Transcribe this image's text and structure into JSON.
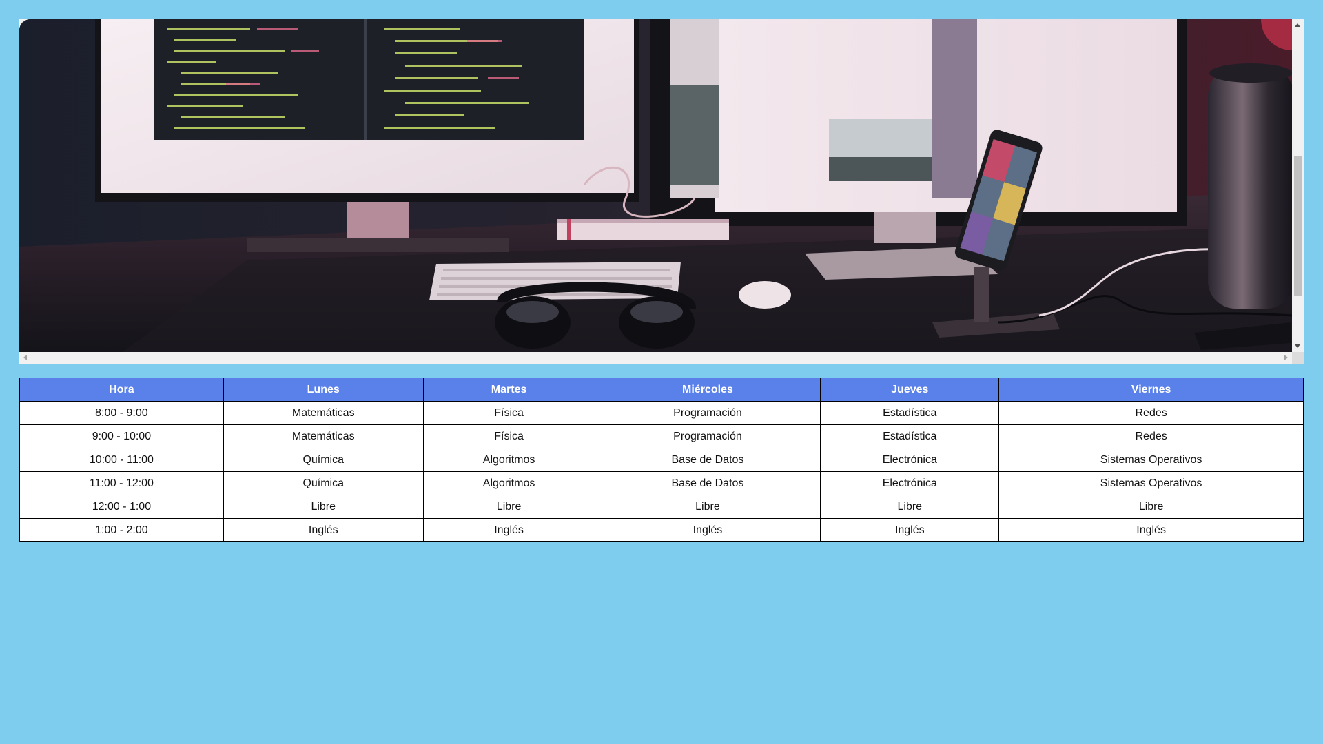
{
  "colors": {
    "page_background": "#7ecdef",
    "table_header": "#5a80ea",
    "table_header_text": "#ffffff",
    "table_cell_background": "#ffffff",
    "table_border": "#000000"
  },
  "banner": {
    "image_description_icon": "photo-icon"
  },
  "schedule": {
    "headers": [
      "Hora",
      "Lunes",
      "Martes",
      "Miércoles",
      "Jueves",
      "Viernes"
    ],
    "rows": [
      [
        "8:00 - 9:00",
        "Matemáticas",
        "Física",
        "Programación",
        "Estadística",
        "Redes"
      ],
      [
        "9:00 - 10:00",
        "Matemáticas",
        "Física",
        "Programación",
        "Estadística",
        "Redes"
      ],
      [
        "10:00 - 11:00",
        "Química",
        "Algoritmos",
        "Base de Datos",
        "Electrónica",
        "Sistemas Operativos"
      ],
      [
        "11:00 - 12:00",
        "Química",
        "Algoritmos",
        "Base de Datos",
        "Electrónica",
        "Sistemas Operativos"
      ],
      [
        "12:00 - 1:00",
        "Libre",
        "Libre",
        "Libre",
        "Libre",
        "Libre"
      ],
      [
        "1:00 - 2:00",
        "Inglés",
        "Inglés",
        "Inglés",
        "Inglés",
        "Inglés"
      ]
    ]
  }
}
